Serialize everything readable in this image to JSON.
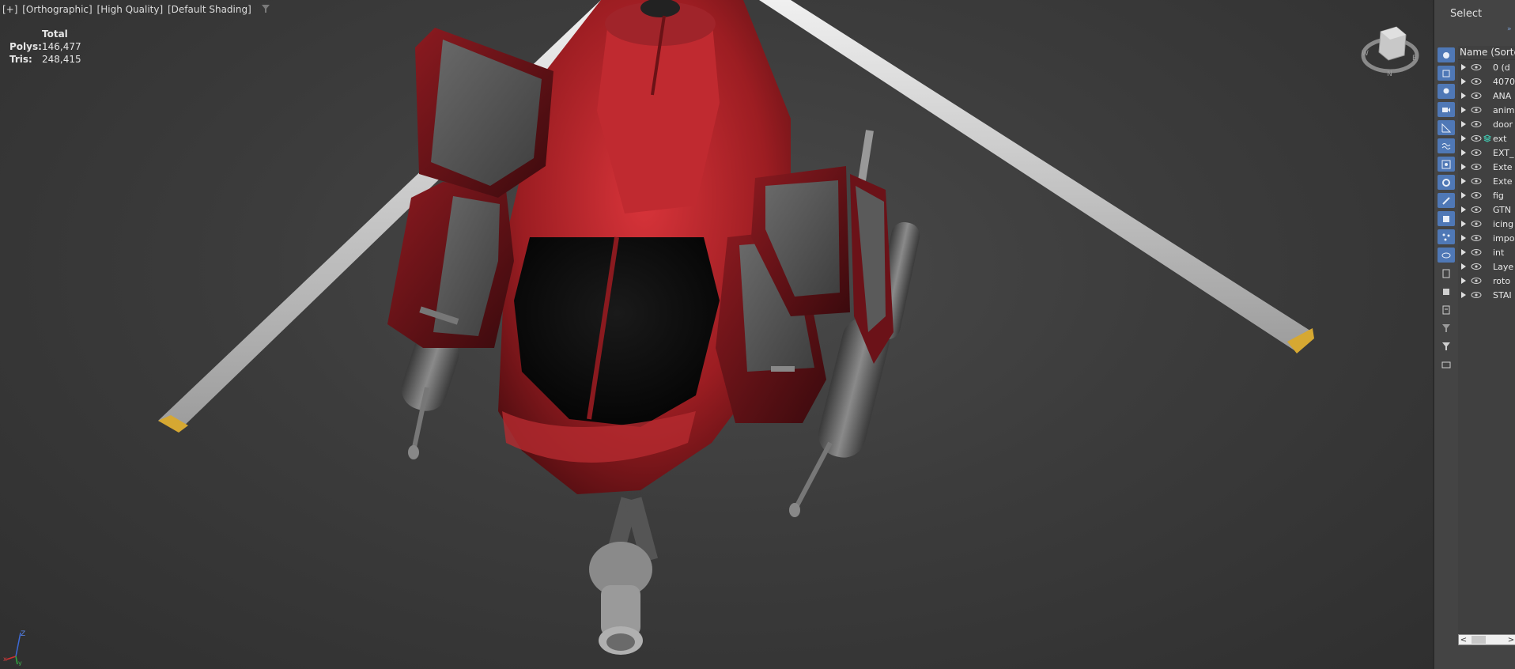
{
  "viewport": {
    "label_parts": [
      "[+]",
      "[Orthographic]",
      "[High Quality]",
      "[Default Shading]"
    ],
    "filter_icon": "funnel-icon"
  },
  "stats": {
    "header": "Total",
    "polys_label": "Polys:",
    "polys_value": "146,477",
    "tris_label": "Tris:",
    "tris_value": "248,415"
  },
  "viewcube": {
    "compass_n": "N",
    "compass_e": "E",
    "compass_w": "W"
  },
  "axis": {
    "z": "Z",
    "x": "x",
    "y": "y"
  },
  "panel": {
    "title": "Select",
    "list_header": "Name (Sorted A",
    "toolbar_icons": [
      "geometry-icon",
      "shapes-icon",
      "lights-icon",
      "cameras-icon",
      "helpers-icon",
      "spacewarps-icon",
      "groups-icon",
      "xrefs-icon",
      "bones-icon",
      "containers-icon",
      "particles-icon",
      "frozen-icon",
      "layers-page-icon",
      "hide-icon",
      "properties-icon",
      "filter-tool-icon",
      "filter-icon",
      "find-icon"
    ],
    "layers": [
      {
        "name": "0 (d"
      },
      {
        "name": "4070"
      },
      {
        "name": "ANA"
      },
      {
        "name": "anim"
      },
      {
        "name": "door"
      },
      {
        "name": "ext"
      },
      {
        "name": "EXT_"
      },
      {
        "name": "Exte"
      },
      {
        "name": "Exte"
      },
      {
        "name": "fig"
      },
      {
        "name": "GTN"
      },
      {
        "name": "icing"
      },
      {
        "name": "impo"
      },
      {
        "name": "int"
      },
      {
        "name": "Laye"
      },
      {
        "name": "roto"
      },
      {
        "name": "STAI"
      }
    ],
    "active_layer_index": 5
  },
  "colors": {
    "accent": "#4f78b6",
    "body_red": "#b5232a",
    "rotor": "#d9d9d9",
    "rotor_tip": "#d6a832"
  }
}
